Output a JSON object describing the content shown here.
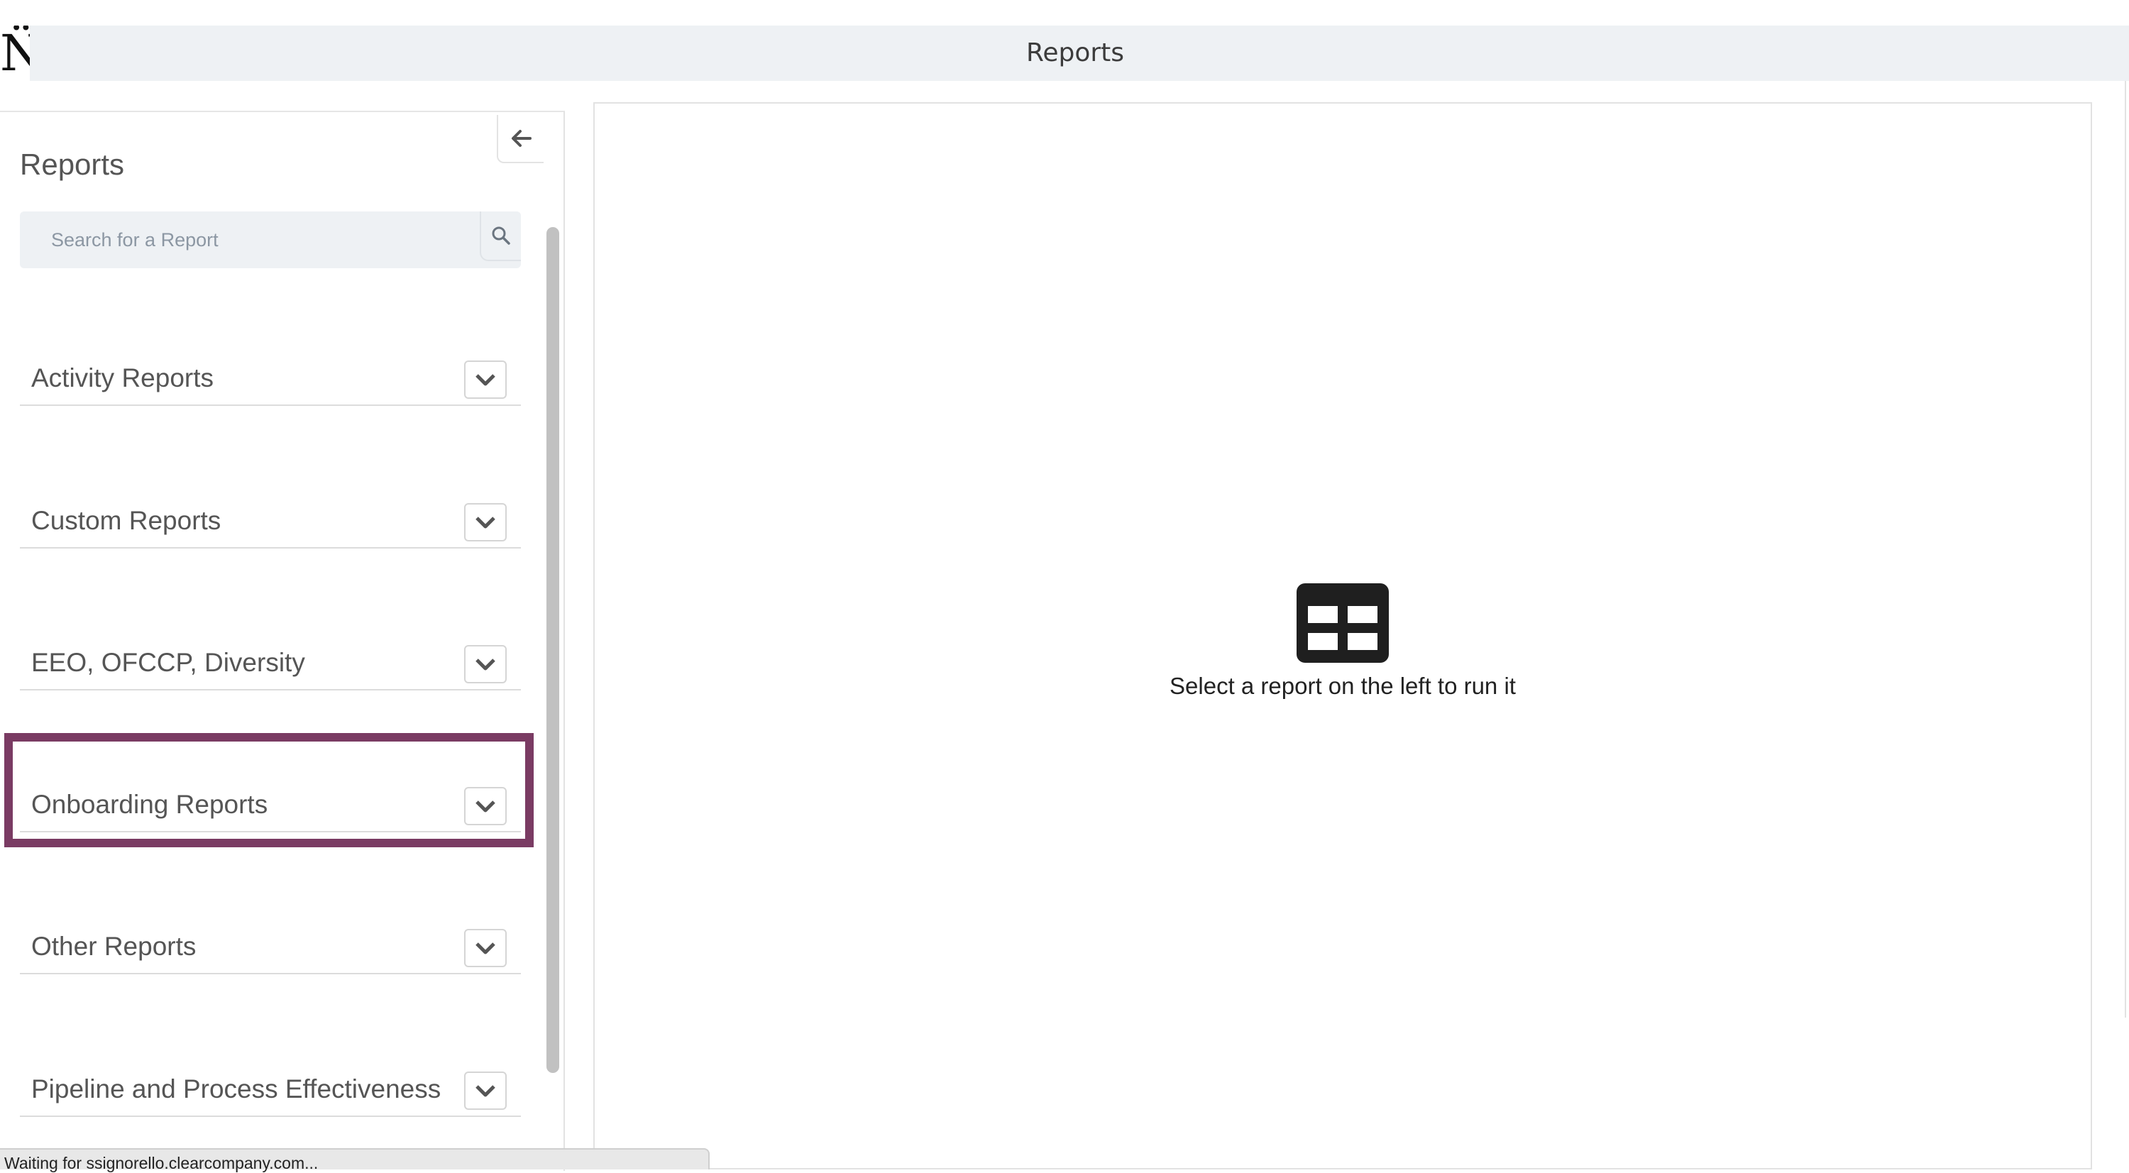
{
  "header": {
    "logo_glyph": "N̈",
    "title": "Reports"
  },
  "sidebar": {
    "collapse_icon": "arrow-left-icon",
    "title": "Reports",
    "search": {
      "placeholder": "Search for a Report",
      "value": "",
      "icon": "search-icon"
    },
    "categories": [
      {
        "label": "Activity Reports",
        "expanded": false,
        "icon": "chevron-down-icon"
      },
      {
        "label": "Custom Reports",
        "expanded": false,
        "icon": "chevron-down-icon"
      },
      {
        "label": "EEO, OFCCP, Diversity",
        "expanded": false,
        "icon": "chevron-down-icon"
      },
      {
        "label": "Onboarding Reports",
        "expanded": false,
        "icon": "chevron-down-icon",
        "highlighted": true
      },
      {
        "label": "Other Reports",
        "expanded": false,
        "icon": "chevron-down-icon"
      },
      {
        "label": "Pipeline and Process Effectiveness",
        "expanded": false,
        "icon": "chevron-down-icon"
      }
    ]
  },
  "main": {
    "empty_icon": "table-icon",
    "empty_message": "Select a report on the left to run it"
  },
  "status_bar": {
    "text": "Waiting for ssignorello.clearcompany.com..."
  },
  "colors": {
    "highlight": "#7a3b63",
    "header_bg": "#eef1f4",
    "search_bg": "#eef1f4"
  }
}
